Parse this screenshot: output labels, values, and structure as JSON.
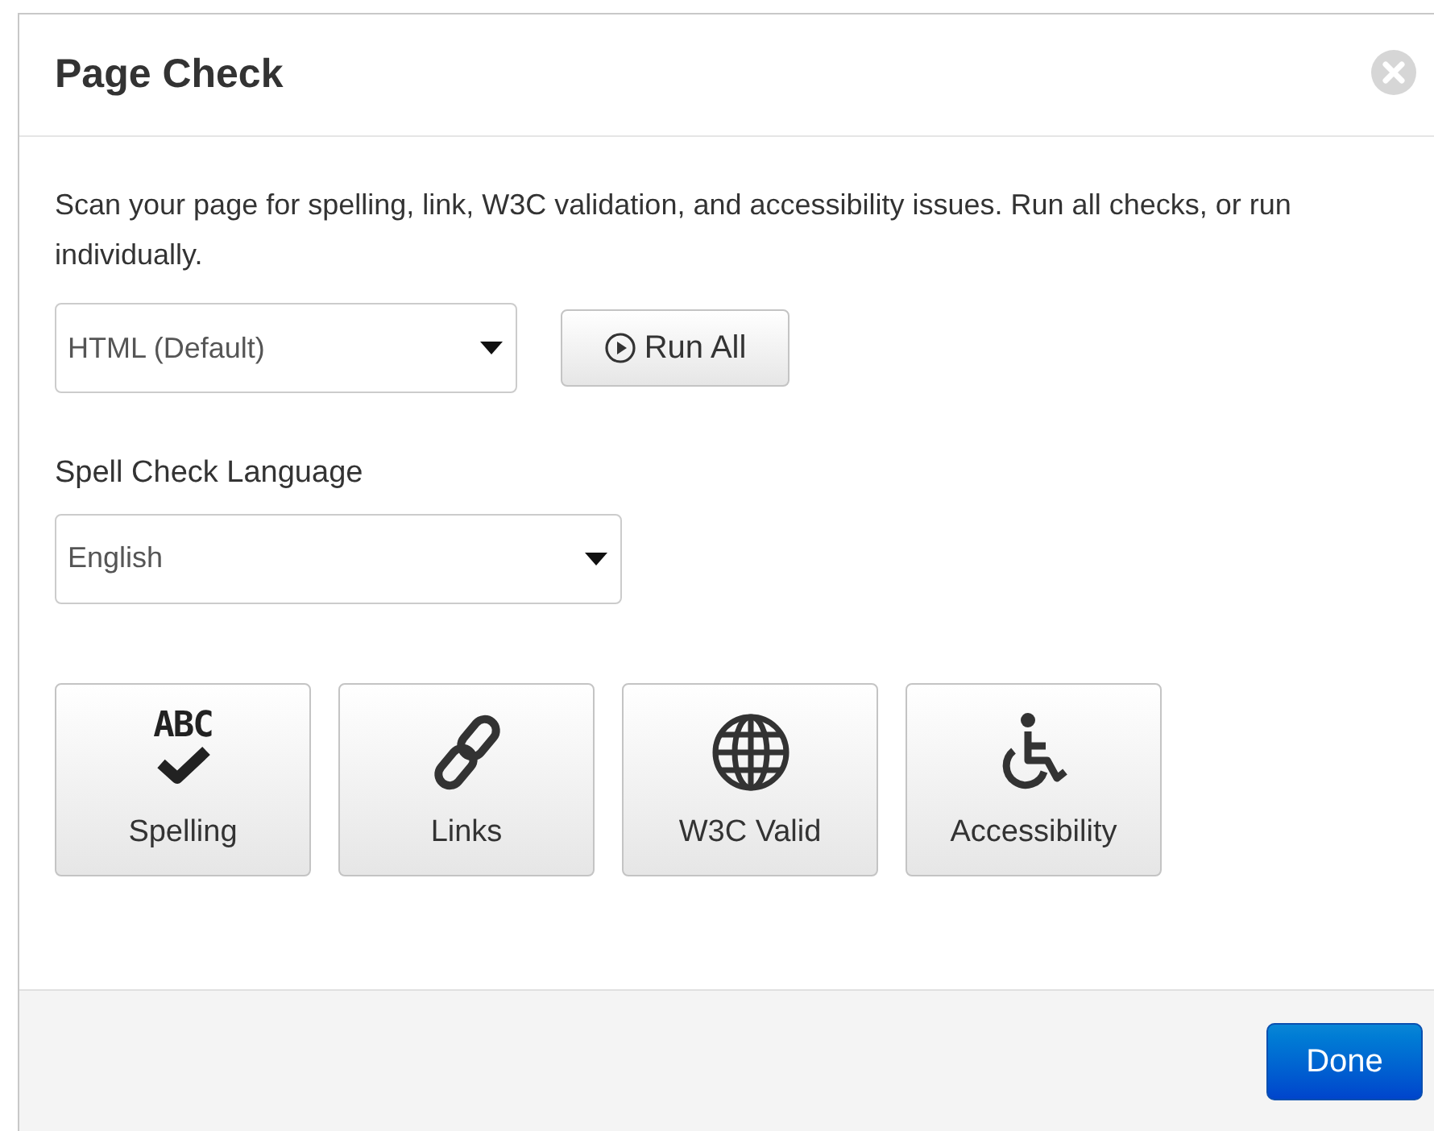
{
  "dialog": {
    "title": "Page Check"
  },
  "description": "Scan your page for spelling, link, W3C validation, and accessibility issues. Run all checks, or run individually.",
  "mode_select": {
    "value": "HTML (Default)"
  },
  "run_all_button": {
    "label": "Run All"
  },
  "language": {
    "label": "Spell Check Language",
    "value": "English"
  },
  "checks": [
    {
      "kind": "spelling",
      "label": "Spelling",
      "icon_text": "ABC"
    },
    {
      "kind": "links",
      "label": "Links"
    },
    {
      "kind": "w3c",
      "label": "W3C Valid"
    },
    {
      "kind": "accessibility",
      "label": "Accessibility"
    }
  ],
  "footer": {
    "done_button": "Done"
  }
}
